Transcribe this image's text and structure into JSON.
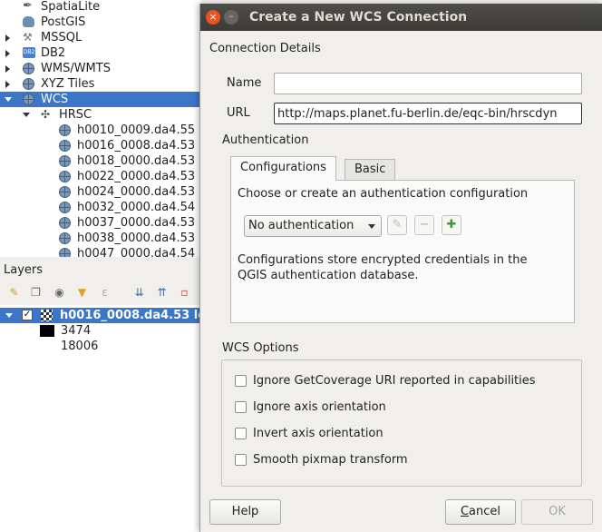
{
  "browser": {
    "items": [
      {
        "label": "SpatiaLite",
        "icon": "feather-icon",
        "expander": "none",
        "level": 0
      },
      {
        "label": "PostGIS",
        "icon": "elephant-icon",
        "expander": "none",
        "level": 0
      },
      {
        "label": "MSSQL",
        "icon": "wrench-icon",
        "expander": "collapsed",
        "level": 0
      },
      {
        "label": "DB2",
        "icon": "db2-icon",
        "icon_text": "DB2",
        "expander": "collapsed",
        "level": 0
      },
      {
        "label": "WMS/WMTS",
        "icon": "globe-icon",
        "expander": "collapsed",
        "level": 0
      },
      {
        "label": "XYZ Tiles",
        "icon": "globe-icon",
        "expander": "collapsed",
        "level": 0
      },
      {
        "label": "WCS",
        "icon": "globe-icon",
        "expander": "expanded",
        "level": 0,
        "selected": true
      },
      {
        "label": "HRSC",
        "icon": "hrsc-icon",
        "expander": "expanded",
        "level": 1
      },
      {
        "label": "h0010_0009.da4.55",
        "icon": "globe-icon",
        "level": 2
      },
      {
        "label": "h0016_0008.da4.53",
        "icon": "globe-icon",
        "level": 2
      },
      {
        "label": "h0018_0000.da4.53",
        "icon": "globe-icon",
        "level": 2
      },
      {
        "label": "h0022_0000.da4.53",
        "icon": "globe-icon",
        "level": 2
      },
      {
        "label": "h0024_0000.da4.53",
        "icon": "globe-icon",
        "level": 2
      },
      {
        "label": "h0032_0000.da4.54",
        "icon": "globe-icon",
        "level": 2
      },
      {
        "label": "h0037_0000.da4.53",
        "icon": "globe-icon",
        "level": 2
      },
      {
        "label": "h0038_0000.da4.53",
        "icon": "globe-icon",
        "level": 2
      },
      {
        "label": "h0047_0000.da4.54",
        "icon": "globe-icon",
        "level": 2
      }
    ]
  },
  "layers": {
    "title": "Layers",
    "toolbar_icons": [
      "paint-brush-icon",
      "add-group-icon",
      "eye-icon",
      "filter-icon",
      "expression-filter-icon",
      "expand-all-icon",
      "collapse-all-icon",
      "remove-layer-icon"
    ],
    "layer": {
      "name": "h0016_0008.da4.53 lo",
      "checked": "✓"
    },
    "legend": {
      "value_high": "3474",
      "value_low": "18006"
    }
  },
  "dialog": {
    "title": "Create a New WCS Connection",
    "close_glyph": "×",
    "minimize_glyph": "–",
    "connection_details": "Connection Details",
    "name_label": "Name",
    "name_value": "",
    "url_label": "URL",
    "url_value": "http://maps.planet.fu-berlin.de/eqc-bin/hrscdyn",
    "authentication": {
      "title": "Authentication",
      "tabs": [
        "Configurations",
        "Basic"
      ],
      "choose_text": "Choose or create an authentication configuration",
      "select_value": "No authentication",
      "info_line1": "Configurations store encrypted credentials in the",
      "info_line2": "QGIS authentication database.",
      "edit_glyph": "✎",
      "remove_glyph": "−",
      "add_glyph": "✚"
    },
    "wcs_options": {
      "title": "WCS Options",
      "checkboxes": [
        "Ignore GetCoverage URI reported in capabilities",
        "Ignore axis orientation",
        "Invert axis orientation",
        "Smooth pixmap transform"
      ]
    },
    "buttons": {
      "help": "Help",
      "cancel_first": "C",
      "cancel_rest": "ancel",
      "ok": "OK"
    }
  },
  "colors": {
    "selection": "#3b76c8",
    "close_button": "#e95420",
    "titlebar": "#3c3b37"
  }
}
